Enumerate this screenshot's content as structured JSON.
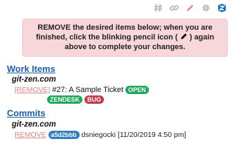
{
  "toolbar": {
    "icons": [
      "hash-icon",
      "link-icon",
      "pencil-icon",
      "gear-icon",
      "logo-icon"
    ],
    "colors": {
      "muted": "#b5b5b5",
      "pencil": "#e58a8a",
      "logo": "#1b6fb3"
    }
  },
  "alert": {
    "line1": "REMOVE the desired items below; when you are",
    "line2_before": "finished, click the blinking pencil icon (",
    "line2_after": ") again",
    "line3": "above to complete your changes."
  },
  "work_items": {
    "title": "Work Items",
    "repo": "git-zen.com",
    "item": {
      "remove": "[REMOVE]",
      "ticket": "#27: A Sample Ticket",
      "status": "OPEN",
      "tags": [
        "ZENDESK",
        "BUG"
      ]
    }
  },
  "commits": {
    "title": "Commits",
    "repo": "git-zen.com",
    "item": {
      "remove": "REMOVE",
      "hash": "a5d2bbb",
      "meta": "dsniegocki [11/20/2019 4:50 pm]"
    }
  }
}
